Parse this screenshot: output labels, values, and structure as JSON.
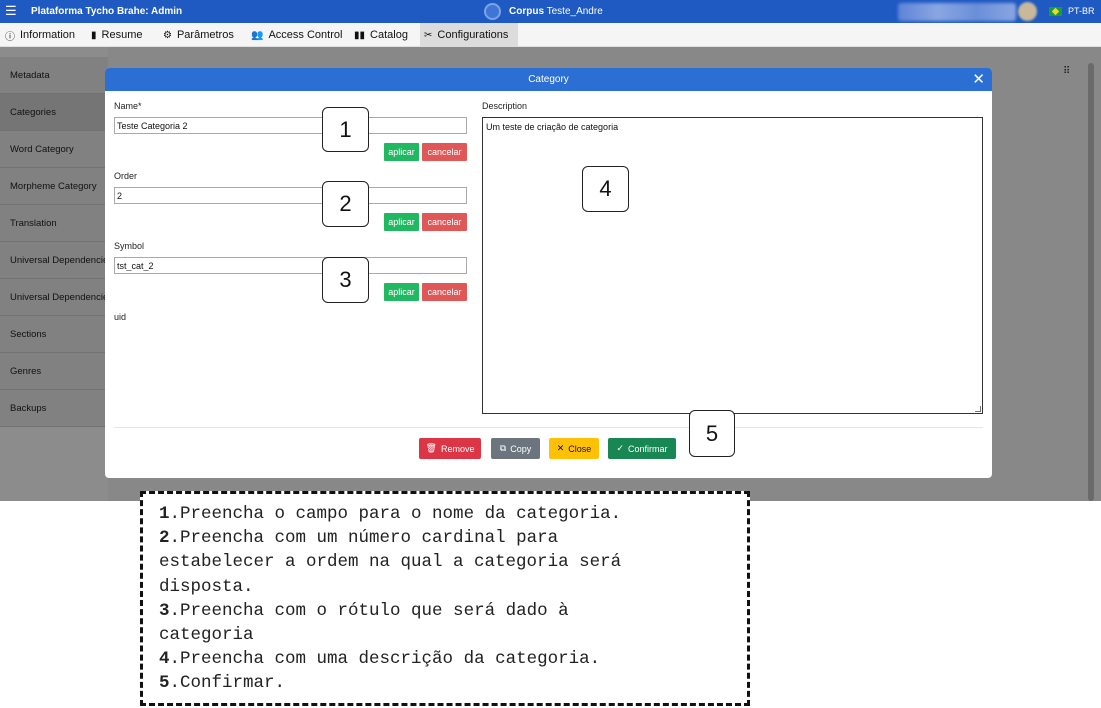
{
  "topbar": {
    "menu_glyph": "☰",
    "app_title": "Plataforma Tycho Brahe: Admin",
    "corpus_label": "Corpus",
    "corpus_name": "Teste_Andre",
    "language": "PT-BR"
  },
  "tabs": [
    {
      "icon": "info-icon",
      "glyph": "ⓘ",
      "label": "Information"
    },
    {
      "icon": "document-icon",
      "glyph": "▮",
      "label": "Resume"
    },
    {
      "icon": "gears-icon",
      "glyph": "⚙",
      "label": "Parâmetros"
    },
    {
      "icon": "users-icon",
      "glyph": "👥",
      "label": "Access Control"
    },
    {
      "icon": "book-icon",
      "glyph": "▮▮",
      "label": "Catalog"
    },
    {
      "icon": "tools-icon",
      "glyph": "✂",
      "label": "Configurations"
    }
  ],
  "sidebar": {
    "items": [
      {
        "label": "Metadata"
      },
      {
        "label": "Categories"
      },
      {
        "label": "Word Category"
      },
      {
        "label": "Morpheme Category"
      },
      {
        "label": "Translation"
      },
      {
        "label": "Universal Dependencies"
      },
      {
        "label": "Universal Dependencies"
      },
      {
        "label": "Sections"
      },
      {
        "label": "Genres"
      },
      {
        "label": "Backups"
      }
    ]
  },
  "content": {
    "drag_glyph": "⠿"
  },
  "modal": {
    "title": "Category",
    "close_glyph": "✕",
    "fields": {
      "name": {
        "label": "Name*",
        "value": "Teste Categoria 2"
      },
      "order": {
        "label": "Order",
        "value": "2"
      },
      "symbol": {
        "label": "Symbol",
        "value": "tst_cat_2"
      },
      "uid": {
        "label": "uid"
      }
    },
    "apply_label": "aplicar",
    "cancel_label": "cancelar",
    "description": {
      "label": "Description",
      "value": "Um teste de criação de categoria"
    },
    "buttons": {
      "remove": {
        "glyph": "🗑",
        "label": "Remove"
      },
      "copy": {
        "glyph": "⧉",
        "label": "Copy"
      },
      "close": {
        "glyph": "✕",
        "label": "Close"
      },
      "confirm": {
        "glyph": "✓",
        "label": "Confirmar"
      }
    }
  },
  "callouts": [
    "1",
    "2",
    "3",
    "4",
    "5"
  ],
  "instructions": [
    {
      "num": "1",
      "text": ".Preencha o campo para o nome da categoria."
    },
    {
      "num": "2",
      "text": ".Preencha com um número cardinal para"
    },
    {
      "num": "",
      "text": "estabelecer a ordem na qual a categoria será"
    },
    {
      "num": "",
      "text": "disposta."
    },
    {
      "num": "3",
      "text": ".Preencha com o rótulo que será dado à"
    },
    {
      "num": "",
      "text": "categoria"
    },
    {
      "num": "4",
      "text": ".Preencha com uma descrição da categoria."
    },
    {
      "num": "5",
      "text": ".Confirmar."
    }
  ],
  "colors": {
    "topbar": "#1f59c2",
    "modal_header": "#2b6fd4",
    "apply": "#21b862",
    "cancel": "#e05757",
    "remove": "#dc3545",
    "copy": "#6c757d",
    "close": "#ffc107",
    "confirm": "#198754"
  }
}
